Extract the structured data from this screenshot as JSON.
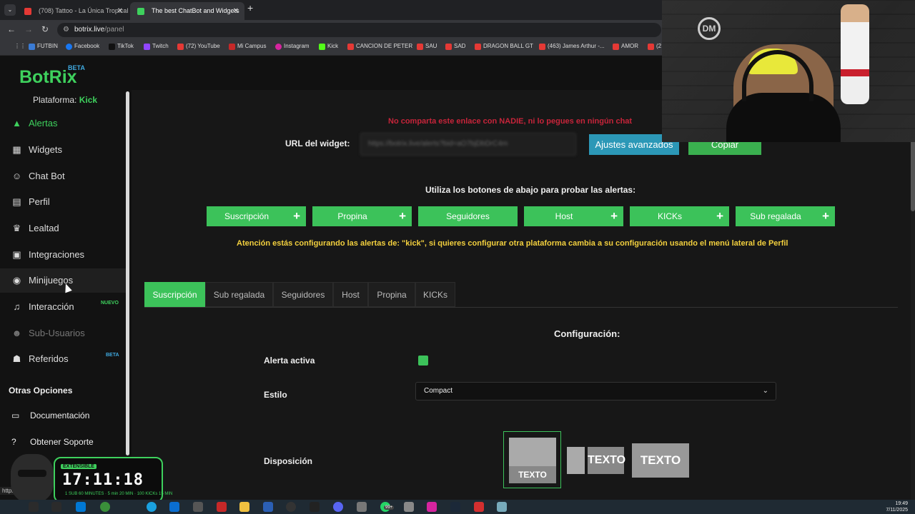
{
  "browser": {
    "tabs": [
      {
        "title": "(708) Tattoo - La Única Tropical",
        "active": false
      },
      {
        "title": "The best ChatBot and Widgets",
        "active": true
      }
    ],
    "url_domain": "botrix.live",
    "url_path": "/panel",
    "bookmarks": [
      "FUTBIN",
      "Facebook",
      "TikTok",
      "Twitch",
      "(72) YouTube",
      "Mi Campus",
      "Instagram",
      "Kick",
      "CANCION DE PETER",
      "SAU",
      "SAD",
      "DRAGON BALL GT",
      "(463) James Arthur -...",
      "AMOR",
      "(2"
    ]
  },
  "app": {
    "logo": "BotRix",
    "logo_badge": "BETA",
    "platform_label": "Plataforma:",
    "platform_value": "Kick"
  },
  "sidebar": {
    "items": [
      {
        "label": "Alertas",
        "icon": "warning-icon",
        "state": "active"
      },
      {
        "label": "Widgets",
        "icon": "grid-icon",
        "state": "normal"
      },
      {
        "label": "Chat Bot",
        "icon": "robot-icon",
        "state": "normal"
      },
      {
        "label": "Perfil",
        "icon": "id-card-icon",
        "state": "normal"
      },
      {
        "label": "Lealtad",
        "icon": "trophy-icon",
        "state": "normal"
      },
      {
        "label": "Integraciones",
        "icon": "integration-icon",
        "state": "normal"
      },
      {
        "label": "Minijuegos",
        "icon": "gamepad-icon",
        "state": "hover"
      },
      {
        "label": "Interacción",
        "icon": "music-icon",
        "state": "normal",
        "tag": "NUEVO"
      },
      {
        "label": "Sub-Usuarios",
        "icon": "users-icon",
        "state": "disabled"
      },
      {
        "label": "Referidos",
        "icon": "people-icon",
        "state": "normal",
        "tag": "BETA"
      }
    ],
    "other_title": "Otras Opciones",
    "other_items": [
      {
        "label": "Documentación",
        "icon": "document-icon"
      },
      {
        "label": "Obtener Soporte",
        "icon": "help-icon"
      }
    ]
  },
  "main": {
    "warning": "No comparta este enlace con NADIE, ni lo pegues en ningún chat",
    "url_label": "URL del widget:",
    "url_value": "https://botrix.live/alerts?bid=aO7bjDbDrC4m",
    "advanced_button": "Ajustes avanzados",
    "copy_button": "Copiar",
    "test_hint": "Utiliza los botones de abajo para probar las alertas:",
    "test_buttons": [
      "Suscripción",
      "Propina",
      "Seguidores",
      "Host",
      "KICKs",
      "Sub regalada"
    ],
    "attention": "Atención estás configurando las alertas de: \"kick\", si quieres configurar otra plataforma cambia a su configuración usando el menú lateral de Perfil",
    "tabs": [
      "Suscripción",
      "Sub regalada",
      "Seguidores",
      "Host",
      "Propina",
      "KICKs"
    ],
    "active_tab": "Suscripción",
    "config_title": "Configuración:",
    "alert_active_label": "Alerta activa",
    "alert_active": true,
    "style_label": "Estilo",
    "style_value": "Compact",
    "layout_label": "Disposición",
    "layout_option_text": "TEXTO"
  },
  "overlay": {
    "badge": "EXTENSIBLE",
    "timer": "17:11:18",
    "stats": "1 SUB 60 MINUTES · 5 min 20 MIN · 100 KICKs 15 MIN"
  },
  "taskbar": {
    "time": "19:49",
    "date": "7/11/2025",
    "notification_count": "99+"
  },
  "status_url": "https:"
}
